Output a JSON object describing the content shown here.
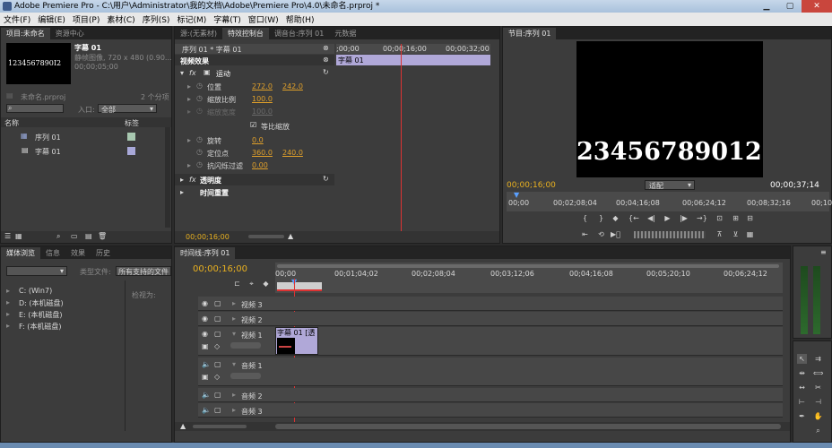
{
  "window": {
    "title": "Adobe Premiere Pro - C:\\用户\\Administrator\\我的文档\\Adobe\\Premiere Pro\\4.0\\未命名.prproj *"
  },
  "menu": [
    "文件(F)",
    "编辑(E)",
    "项目(P)",
    "素材(C)",
    "序列(S)",
    "标记(M)",
    "字幕(T)",
    "窗口(W)",
    "帮助(H)"
  ],
  "project": {
    "tabs": [
      "项目:未命名",
      "资源中心"
    ],
    "clip_name": "字幕 01",
    "clip_info1": "静帧图像, 720 x 480 (0.90...",
    "clip_info2": "00;00;05;00",
    "thumb_text": "1234567890I2",
    "file": "未命名.prproj",
    "count": "2 个分项",
    "entry_label": "入口:",
    "entry_value": "全部",
    "col_name": "名称",
    "col_label": "标签",
    "items": [
      {
        "name": "序列 01",
        "color": "#a8c8b0"
      },
      {
        "name": "字幕 01",
        "color": "#a8a8d8"
      }
    ]
  },
  "effect_controls": {
    "tabs": [
      "源:(无素材)",
      "特效控制台",
      "调音台:序列 01",
      "元数据"
    ],
    "header": "序列 01 * 字幕 01",
    "time0": ";00;00",
    "time1": "00;00;16;00",
    "time2": "00;00;32;00",
    "clip_bar": "字幕 01",
    "section": "视频效果",
    "motion": "运动",
    "props": [
      {
        "name": "位置",
        "v1": "272.0",
        "v2": "242.0"
      },
      {
        "name": "缩放比例",
        "v1": "100.0",
        "v2": ""
      },
      {
        "name": "缩放宽度",
        "v1": "100.0",
        "v2": ""
      },
      {
        "name": "",
        "v1": "",
        "v2": ""
      },
      {
        "name": "旋转",
        "v1": "0.0",
        "v2": ""
      },
      {
        "name": "定位点",
        "v1": "360.0",
        "v2": "240.0"
      },
      {
        "name": "抗闪烁过滤",
        "v1": "0.00",
        "v2": ""
      }
    ],
    "uniform": "等比缩放",
    "opacity": "透明度",
    "remap": "时间重置",
    "footer_time": "00;00;16;00"
  },
  "program": {
    "tab": "节目:序列 01",
    "video_text": "23456789012",
    "time_current": "00;00;16;00",
    "fit": "适配",
    "time_total": "00;00;37;14",
    "ruler": [
      "00;00",
      "00;02;08;04",
      "00;04;16;08",
      "00;06;24;12",
      "00;08;32;16",
      "00;10"
    ]
  },
  "media_browser": {
    "tabs": [
      "媒体浏览",
      "信息",
      "效果",
      "历史"
    ],
    "filetype_label": "类型文件:",
    "filetype_value": "所有支持的文件",
    "view_label": "检视为:",
    "drives": [
      "C: (Win7)",
      "D: (本机磁盘)",
      "E: (本机磁盘)",
      "F: (本机磁盘)"
    ]
  },
  "timeline": {
    "tab": "时间线:序列 01",
    "time": "00;00;16;00",
    "ruler": [
      "00;00",
      "00;01;04;02",
      "00;02;08;04",
      "00;03;12;06",
      "00;04;16;08",
      "00;05;20;10",
      "00;06;24;12"
    ],
    "tracks": [
      "视频 3",
      "视频 2",
      "视频 1",
      "音频 1",
      "音频 2",
      "音频 3"
    ],
    "clip_label": "字幕 01 [透"
  }
}
